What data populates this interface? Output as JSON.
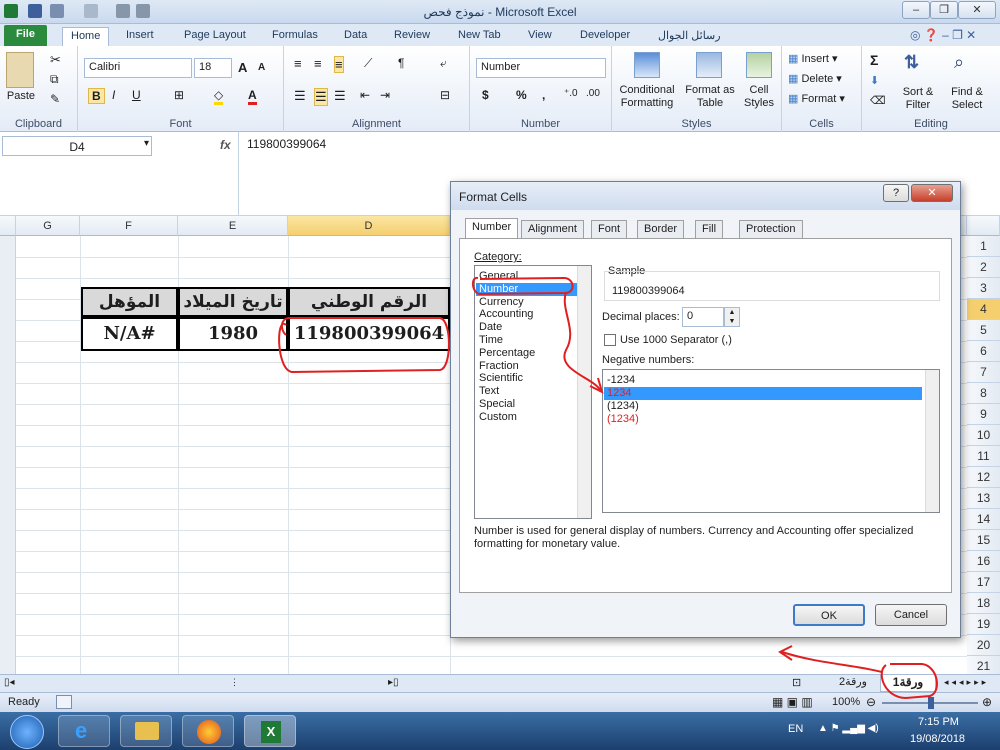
{
  "window": {
    "title": "نموذج فحص  -  Microsoft Excel"
  },
  "ribbon_tabs": [
    "File",
    "Home",
    "Insert",
    "Page Layout",
    "Formulas",
    "Data",
    "Review",
    "New Tab",
    "View",
    "Developer",
    "رسائل الجوال"
  ],
  "ribbon": {
    "clipboard": {
      "label": "Clipboard",
      "paste": "Paste"
    },
    "font": {
      "label": "Font",
      "name": "Calibri",
      "size": "18",
      "bold": "B",
      "italic": "I",
      "underline": "U",
      "grow": "A",
      "shrink": "A"
    },
    "alignment": {
      "label": "Alignment"
    },
    "number": {
      "label": "Number",
      "format": "Number",
      "currency": "$",
      "percent": "%",
      "comma": ","
    },
    "styles": {
      "label": "Styles",
      "conditional": "Conditional Formatting",
      "format_table": "Format as Table",
      "cell_styles": "Cell Styles"
    },
    "cells": {
      "label": "Cells",
      "insert": "Insert",
      "delete": "Delete",
      "format": "Format"
    },
    "editing": {
      "label": "Editing",
      "sort": "Sort & Filter",
      "find": "Find & Select",
      "sigma": "Σ"
    }
  },
  "formula_bar": {
    "name_box": "D4",
    "fx": "fx",
    "value": "119800399064"
  },
  "columns": [
    {
      "label": "G"
    },
    {
      "label": "F"
    },
    {
      "label": "E"
    },
    {
      "label": "D"
    }
  ],
  "rows": [
    "1",
    "2",
    "3",
    "4",
    "5",
    "6",
    "7",
    "8",
    "9",
    "10",
    "11",
    "12",
    "13",
    "14",
    "15",
    "16",
    "17",
    "18",
    "19",
    "20",
    "21"
  ],
  "sheet": {
    "header_row": {
      "qualification": "المؤهل",
      "birth_date": "تاريخ الميلاد",
      "national_id": "الرقم الوطني"
    },
    "data_row": {
      "qualification": "N/A#",
      "birth_date": "1980",
      "national_id": "119800399064"
    }
  },
  "dialog": {
    "title": "Format Cells",
    "tabs": [
      "Number",
      "Alignment",
      "Font",
      "Border",
      "Fill",
      "Protection"
    ],
    "category_label": "Category:",
    "categories": [
      "General",
      "Number",
      "Currency",
      "Accounting",
      "Date",
      "Time",
      "Percentage",
      "Fraction",
      "Scientific",
      "Text",
      "Special",
      "Custom"
    ],
    "selected_category": "Number",
    "sample_label": "Sample",
    "sample_value": "119800399064",
    "decimal_label": "Decimal places:",
    "decimal_value": "0",
    "separator_label": "Use 1000 Separator (,)",
    "negative_label": "Negative numbers:",
    "negatives": [
      "-1234",
      "1234",
      "(1234)",
      "(1234)"
    ],
    "description": "Number is used for general display of numbers.  Currency and Accounting offer specialized formatting for monetary value.",
    "ok": "OK",
    "cancel": "Cancel",
    "help": "?",
    "close": "✕"
  },
  "sheet_tabs": [
    "ورقة1",
    "ورقة2"
  ],
  "status": {
    "ready": "Ready",
    "zoom": "100%"
  },
  "taskbar": {
    "lang": "EN",
    "time": "7:15 PM",
    "date": "19/08/2018"
  },
  "colors": {
    "accent": "#2a8a3e",
    "selection": "#3399ff",
    "annotation": "#e02020"
  }
}
